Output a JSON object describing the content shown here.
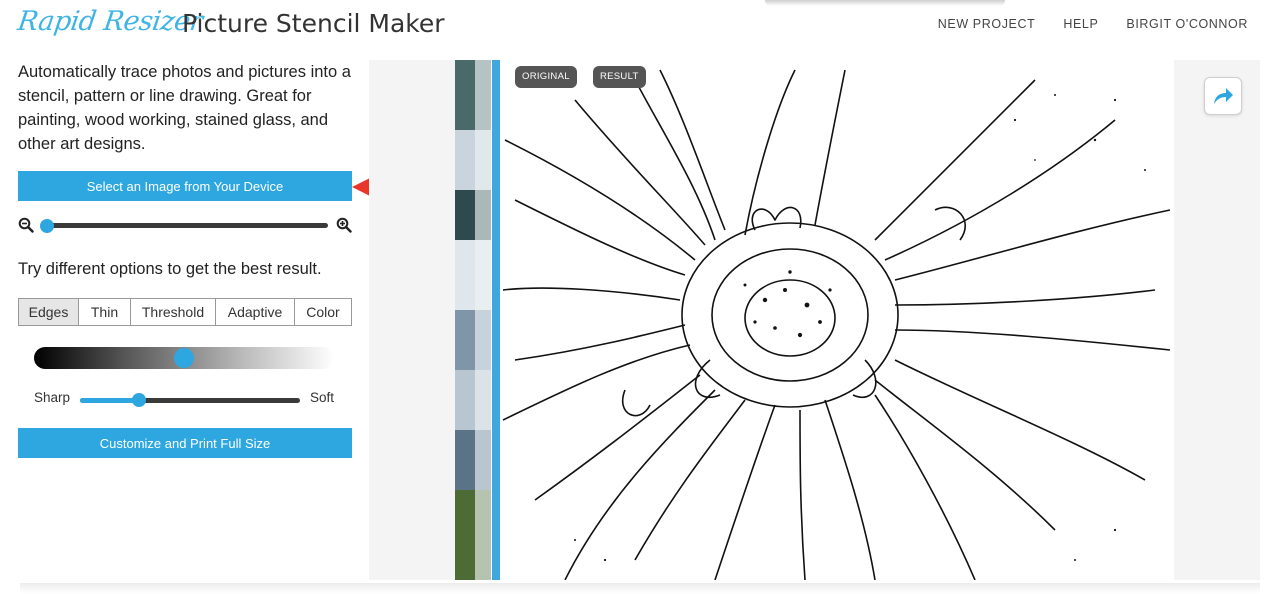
{
  "header": {
    "logo": "Rapid Resizer",
    "title": "Picture Stencil Maker",
    "nav": [
      "NEW PROJECT",
      "HELP",
      "BIRGIT O'CONNOR"
    ]
  },
  "left_panel": {
    "intro": "Automatically trace photos and pictures into a stencil, pattern or line drawing. Great for painting, wood working, stained glass, and other art designs.",
    "select_button": "Select an Image from Your Device",
    "zoom_out_icon": "zoom-out-icon",
    "zoom_in_icon": "zoom-in-icon",
    "zoom_level": 0.0,
    "try_text": "Try different options to get the best result.",
    "tabs": [
      {
        "label": "Edges",
        "active": true
      },
      {
        "label": "Thin",
        "active": false
      },
      {
        "label": "Threshold",
        "active": false
      },
      {
        "label": "Adaptive",
        "active": false
      },
      {
        "label": "Color",
        "active": false
      }
    ],
    "darkness_level": 0.5,
    "sharp_label": "Sharp",
    "soft_label": "Soft",
    "sharpness_level": 0.27,
    "customize_button": "Customize and Print Full Size"
  },
  "canvas": {
    "original_label": "ORIGINAL",
    "result_label": "RESULT",
    "share_icon": "share-arrow-icon"
  },
  "colors": {
    "accent": "#2ea7e0",
    "logo": "#3fb5e4",
    "arrow": "#e8372a",
    "pill": "#555555"
  }
}
